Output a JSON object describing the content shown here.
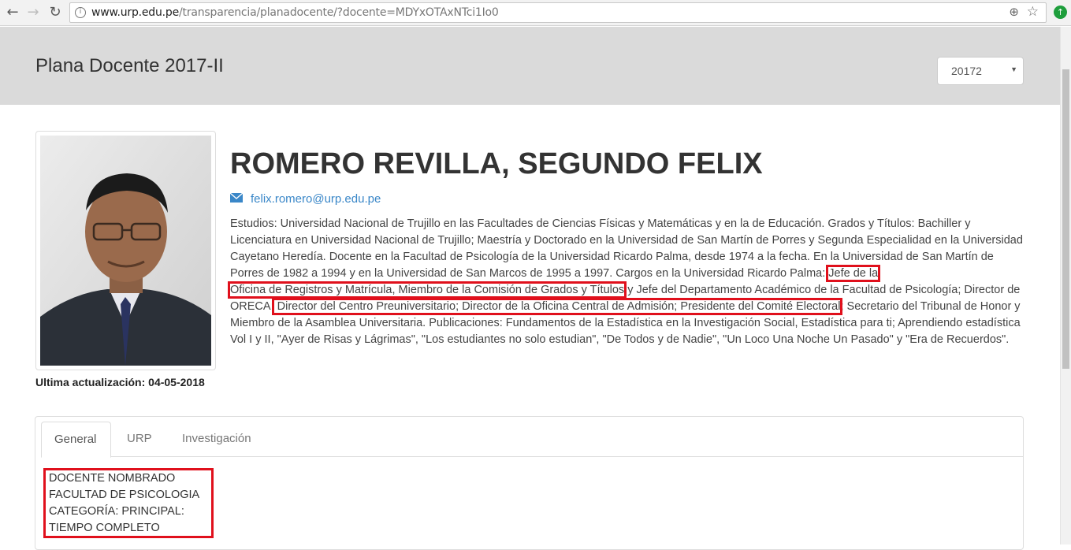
{
  "browser": {
    "url_host": "www.urp.edu.pe",
    "url_path": "/transparencia/planadocente/?docente=MDYxOTAxNTci1Io0"
  },
  "header": {
    "title": "Plana Docente 2017-II",
    "period_select_value": "20172"
  },
  "profile": {
    "name": "ROMERO REVILLA, SEGUNDO FELIX",
    "email": "felix.romero@urp.edu.pe",
    "last_updated_label": "Ultima actualización:",
    "last_updated_date": "04-05-2018",
    "bio": {
      "p1": "Estudios: Universidad Nacional de Trujillo en las Facultades de Ciencias Físicas y Matemáticas y en la de Educación. Grados y Títulos: Bachiller y Licenciatura en Universidad Nacional de Trujillo; Maestría y Doctorado en la Universidad de San Martín de Porres y Segunda Especialidad en la Universidad Cayetano Heredía. Docente en la Facultad de Psicología de la Universidad Ricardo Palma, desde 1974 a la fecha. En la Universidad de San Martín de Porres de 1982 a 1994 y en la Universidad de San Marcos de 1995 a 1997. Cargos en la Universidad Ricardo Palma: ",
      "h1a": "Jefe de la",
      "h1b": "Oficina de Registros y Matrícula, Miembro de la Comisión de Grados y Títulos",
      "p2": " y Jefe del Departamento Académico de la Facultad de Psicología; Director de ORECA;",
      "h2": " Director del Centro Preuniversitario; Director de la Oficina Central de Admisión; Presidente del Comité Electoral",
      "p3": "; Secretario del Tribunal de Honor y Miembro de la Asamblea Universitaria. Publicaciones: Fundamentos de la Estadística en la Investigación Social, Estadística para ti; Aprendiendo estadística Vol I y II, \"Ayer de Risas y Lágrimas\", \"Los estudiantes no solo estudian\", \"De Todos y de Nadie\", \"Un Loco Una Noche Un Pasado\" y \"Era de Recuerdos\"."
    }
  },
  "tabs": {
    "general": "General",
    "urp": "URP",
    "investigacion": "Investigación"
  },
  "general_content": {
    "line1": "DOCENTE NOMBRADO",
    "line2": "FACULTAD DE PSICOLOGIA",
    "line3": "CATEGORÍA: PRINCIPAL:",
    "line4": "TIEMPO COMPLETO"
  },
  "colors": {
    "highlight": "#e0101c",
    "link": "#3a87c8",
    "header_band": "#dadada"
  }
}
